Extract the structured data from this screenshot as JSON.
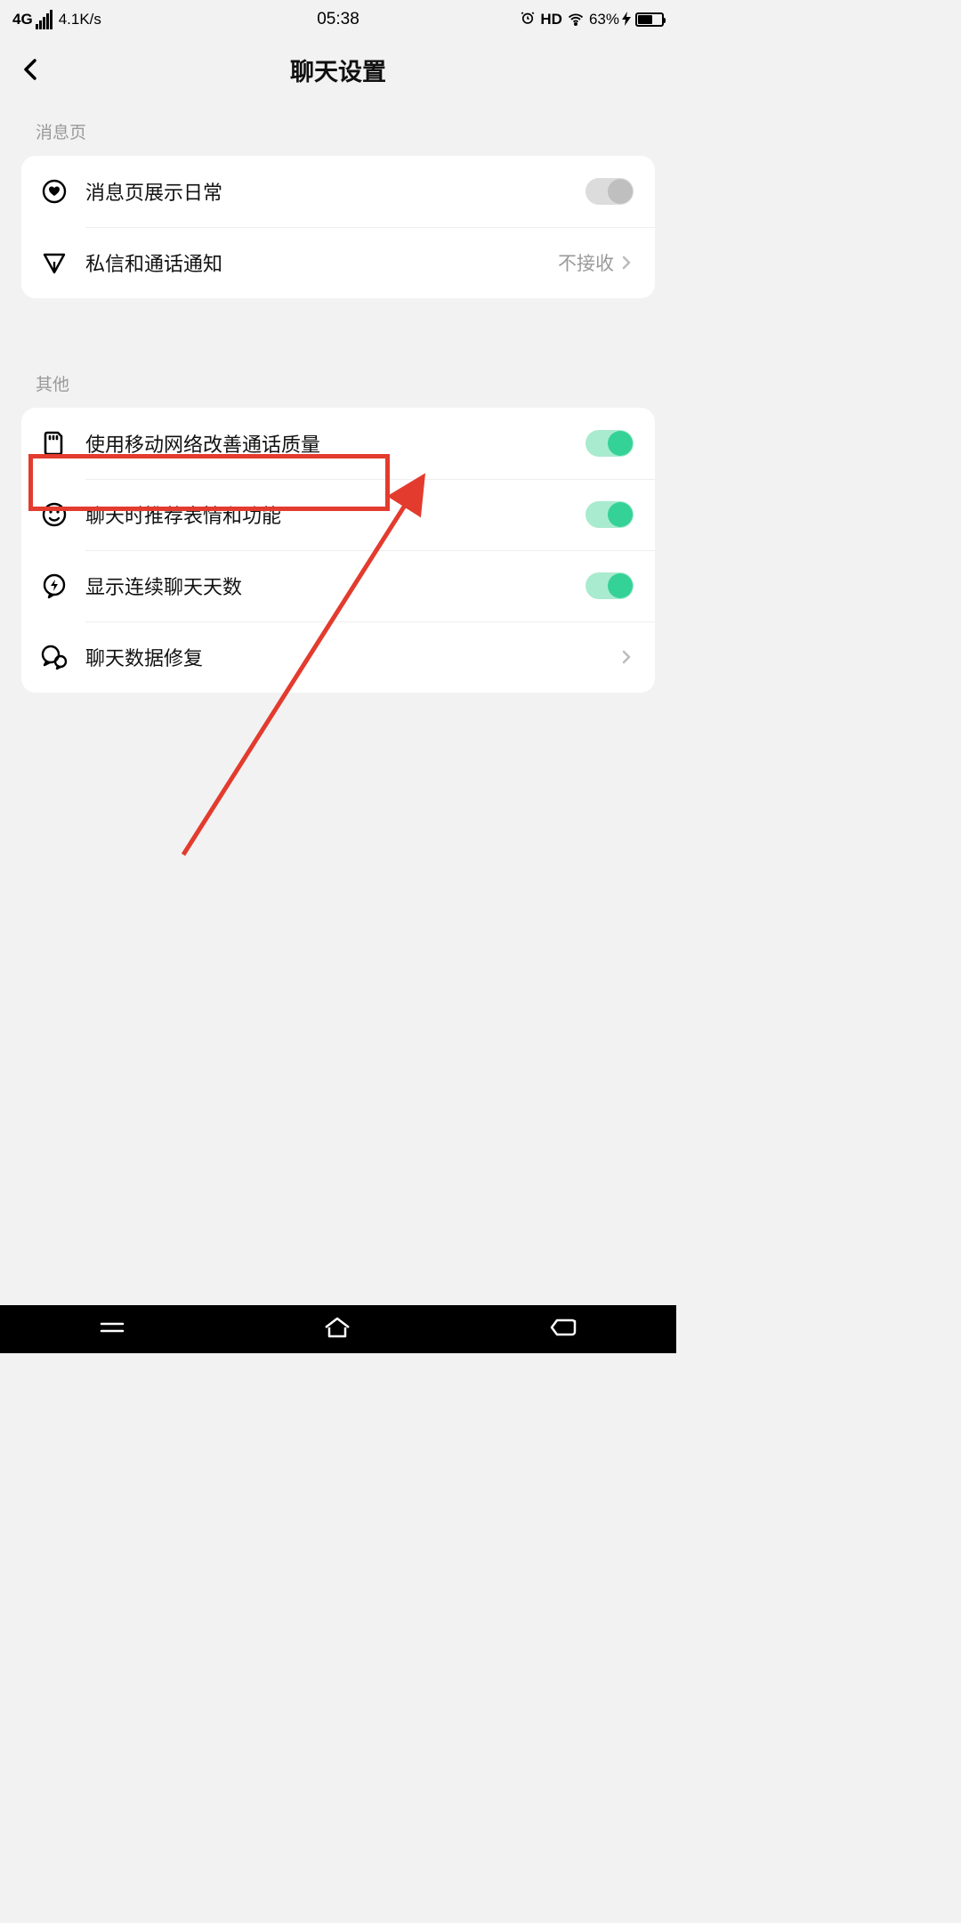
{
  "status": {
    "network_type": "4G",
    "net_speed": "4.1K/s",
    "time": "05:38",
    "hd": "HD",
    "battery_pct": "63%",
    "battery_fill": 63
  },
  "header": {
    "title": "聊天设置"
  },
  "sections": [
    {
      "label": "消息页",
      "rows": [
        {
          "icon": "heart-circle-icon",
          "label": "消息页展示日常",
          "type": "toggle",
          "on": false
        },
        {
          "icon": "send-icon",
          "label": "私信和通话通知",
          "type": "link",
          "value": "不接收"
        }
      ]
    },
    {
      "label": "其他",
      "rows": [
        {
          "icon": "sim-icon",
          "label": "使用移动网络改善通话质量",
          "type": "toggle",
          "on": true
        },
        {
          "icon": "face-icon",
          "label": "聊天时推荐表情和功能",
          "type": "toggle",
          "on": true
        },
        {
          "icon": "bolt-bubble-icon",
          "label": "显示连续聊天天数",
          "type": "toggle",
          "on": true
        },
        {
          "icon": "chat-repair-icon",
          "label": "聊天数据修复",
          "type": "link",
          "value": ""
        }
      ]
    }
  ],
  "annotation": {
    "highlight_row": "聊天时推荐表情和功能"
  }
}
